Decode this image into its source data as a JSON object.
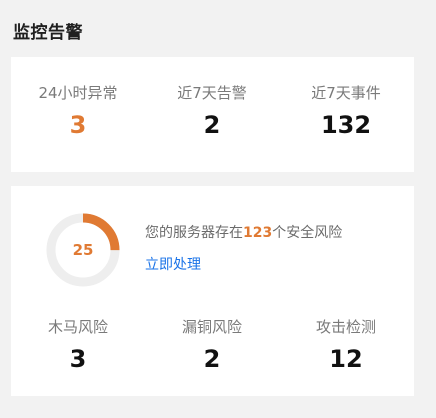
{
  "header": {
    "title": "监控告警"
  },
  "summary": {
    "stats": [
      {
        "label": "24小时异常",
        "value": "3"
      },
      {
        "label": "近7天告警",
        "value": "2"
      },
      {
        "label": "近7天事件",
        "value": "132"
      }
    ]
  },
  "security": {
    "score": "25",
    "score_fraction": 0.25,
    "text_prefix": "您的服务器存在",
    "risk_count": "123",
    "text_suffix": "个安全风险",
    "action_label": "立即处理",
    "risks": [
      {
        "label": "木马风险",
        "value": "3"
      },
      {
        "label": "漏铜风险",
        "value": "2"
      },
      {
        "label": "攻击检测",
        "value": "12"
      }
    ]
  },
  "colors": {
    "accent": "#e07a33",
    "link": "#1a73e8",
    "ring_track": "#eeeeee"
  }
}
